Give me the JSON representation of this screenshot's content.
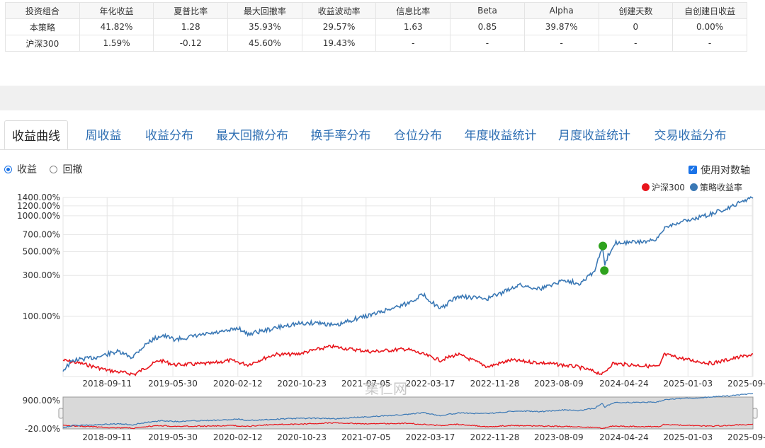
{
  "table": {
    "headers": [
      "投资组合",
      "年化收益",
      "夏普比率",
      "最大回撤率",
      "收益波动率",
      "信息比率",
      "Beta",
      "Alpha",
      "创建天数",
      "自创建日收益"
    ],
    "rows": [
      [
        "本策略",
        "41.82%",
        "1.28",
        "35.93%",
        "29.57%",
        "1.63",
        "0.85",
        "39.87%",
        "0",
        "0.00%"
      ],
      [
        "沪深300",
        "1.59%",
        "-0.12",
        "45.60%",
        "19.43%",
        "-",
        "-",
        "-",
        "-",
        "-"
      ]
    ]
  },
  "tabs": [
    "收益曲线",
    "周收益",
    "收益分布",
    "最大回撤分布",
    "换手率分布",
    "仓位分布",
    "年度收益统计",
    "月度收益统计",
    "交易收益分布"
  ],
  "active_tab": 0,
  "radios": {
    "return_label": "收益",
    "drawdown_label": "回撤",
    "selected": "收益"
  },
  "log_axis": {
    "label": "使用对数轴",
    "checked": true
  },
  "colors": {
    "strategy": "#3a78b5",
    "benchmark": "#e8151c",
    "marker": "#2ea21d"
  },
  "watermark": {
    "line1": "集仁网",
    "line2": "3dorm.com"
  },
  "chart_data": {
    "type": "line",
    "y_scale": "log",
    "series": [
      {
        "name": "沪深300",
        "color": "#e8151c"
      },
      {
        "name": "策略收益率",
        "color": "#3a78b5"
      }
    ],
    "y_ticks": [
      "1400.00%",
      "1200.00%",
      "1000.00%",
      "700.00%",
      "500.00%",
      "300.00%",
      "100.00%"
    ],
    "y_tick_values": [
      1400,
      1200,
      1000,
      700,
      500,
      300,
      100
    ],
    "x_ticks": [
      "2018-09-11",
      "2019-05-30",
      "2020-02-12",
      "2020-10-23",
      "2021-07-05",
      "2022-03-17",
      "2022-11-28",
      "2023-08-09",
      "2024-04-24",
      "2025-01-03",
      "2025-09-15"
    ],
    "x_range": [
      "2018-03-20",
      "2025-09-18"
    ],
    "strategy_points": [
      [
        "2018-03-20",
        -20
      ],
      [
        "2018-05-01",
        -5
      ],
      [
        "2018-08-01",
        0
      ],
      [
        "2018-10-20",
        10
      ],
      [
        "2018-12-20",
        0
      ],
      [
        "2019-02-25",
        30
      ],
      [
        "2019-04-15",
        45
      ],
      [
        "2019-06-10",
        35
      ],
      [
        "2019-09-15",
        45
      ],
      [
        "2019-12-31",
        55
      ],
      [
        "2020-02-15",
        65
      ],
      [
        "2020-03-20",
        48
      ],
      [
        "2020-06-30",
        62
      ],
      [
        "2020-09-15",
        75
      ],
      [
        "2020-12-31",
        80
      ],
      [
        "2021-03-10",
        70
      ],
      [
        "2021-05-15",
        90
      ],
      [
        "2021-08-15",
        110
      ],
      [
        "2021-12-20",
        150
      ],
      [
        "2022-02-15",
        190
      ],
      [
        "2022-04-25",
        125
      ],
      [
        "2022-07-05",
        180
      ],
      [
        "2022-10-31",
        170
      ],
      [
        "2022-12-31",
        200
      ],
      [
        "2023-03-01",
        240
      ],
      [
        "2023-05-31",
        220
      ],
      [
        "2023-08-31",
        270
      ],
      [
        "2023-10-31",
        250
      ],
      [
        "2023-12-31",
        330
      ],
      [
        "2024-02-01",
        560
      ],
      [
        "2024-02-06",
        340
      ],
      [
        "2024-02-20",
        450
      ],
      [
        "2024-03-20",
        600
      ],
      [
        "2024-05-20",
        600
      ],
      [
        "2024-08-30",
        620
      ],
      [
        "2024-10-08",
        820
      ],
      [
        "2024-12-15",
        900
      ],
      [
        "2025-03-15",
        1000
      ],
      [
        "2025-06-15",
        1150
      ],
      [
        "2025-09-18",
        1420
      ]
    ],
    "benchmark_points": [
      [
        "2018-03-20",
        -5
      ],
      [
        "2018-06-01",
        -10
      ],
      [
        "2018-09-15",
        -20
      ],
      [
        "2018-12-31",
        -25
      ],
      [
        "2019-04-08",
        -5
      ],
      [
        "2019-06-06",
        -12
      ],
      [
        "2019-10-31",
        -10
      ],
      [
        "2020-01-13",
        -5
      ],
      [
        "2020-03-23",
        -12
      ],
      [
        "2020-07-09",
        5
      ],
      [
        "2020-09-30",
        5
      ],
      [
        "2021-02-18",
        20
      ],
      [
        "2021-04-30",
        15
      ],
      [
        "2021-07-28",
        10
      ],
      [
        "2021-12-13",
        15
      ],
      [
        "2022-04-26",
        -5
      ],
      [
        "2022-07-04",
        5
      ],
      [
        "2022-10-31",
        -15
      ],
      [
        "2023-01-30",
        -5
      ],
      [
        "2023-06-30",
        -10
      ],
      [
        "2023-10-23",
        -15
      ],
      [
        "2024-02-02",
        -25
      ],
      [
        "2024-03-10",
        -10
      ],
      [
        "2024-09-13",
        -15
      ],
      [
        "2024-09-30",
        5
      ],
      [
        "2025-01-13",
        -5
      ],
      [
        "2025-04-07",
        -10
      ],
      [
        "2025-09-18",
        5
      ]
    ],
    "markers": [
      [
        "2024-01-31",
        560
      ],
      [
        "2024-02-06",
        335
      ]
    ],
    "navigator": {
      "y_labels": [
        "900.00%",
        "-20.00%"
      ],
      "x_ticks": [
        "2018-09-11",
        "2019-05-30",
        "2020-02-12",
        "2020-10-23",
        "2021-07-05",
        "2022-03-17",
        "2022-11-28",
        "2023-08-09",
        "2024-04-24",
        "2025-01-03",
        "2025-09-15"
      ]
    }
  }
}
